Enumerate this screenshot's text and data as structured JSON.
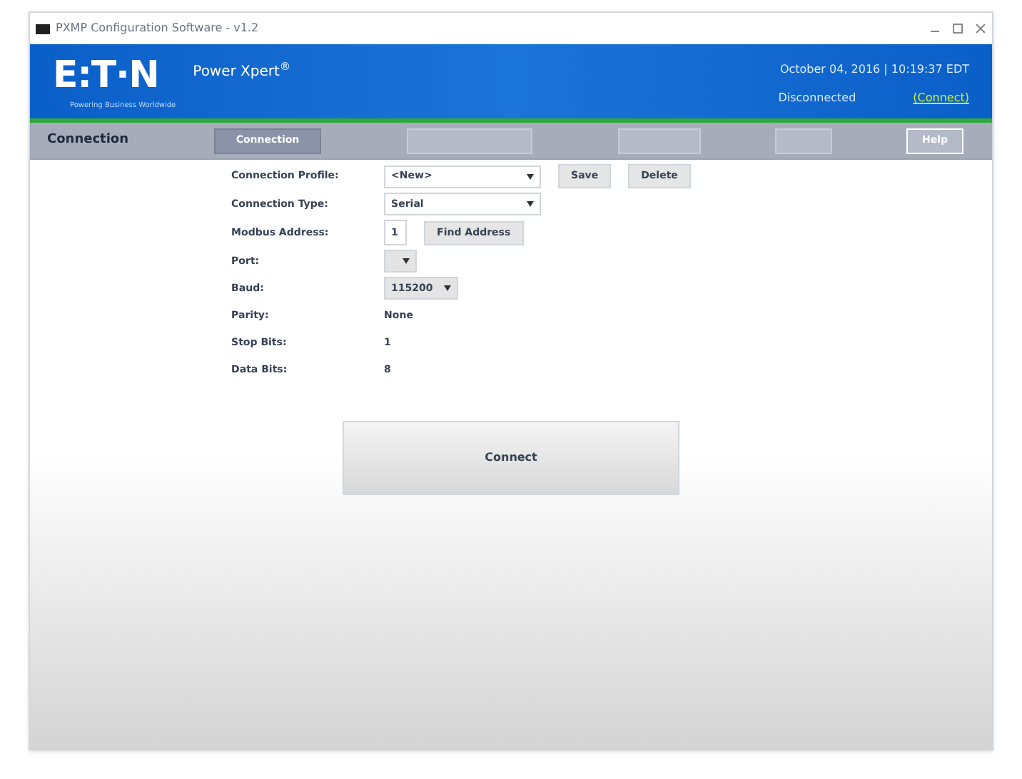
{
  "window": {
    "title": "PXMP Configuration Software - v1.2"
  },
  "header": {
    "logo": "E:T·N",
    "tagline": "Powering Business Worldwide",
    "product": "Power Xpert",
    "product_sup": "®",
    "datetime": "October 04, 2016 | 10:19:37 EDT",
    "status": "Disconnected",
    "connect_link": "(Connect)"
  },
  "section_title": "Connection",
  "tabs": [
    {
      "label": "Connection",
      "selected": true,
      "disabled": false
    },
    {
      "selected": false,
      "disabled": true
    },
    {
      "selected": false,
      "disabled": true
    },
    {
      "selected": false,
      "disabled": true
    },
    {
      "label": "Help",
      "selected": false,
      "disabled": false
    }
  ],
  "form": [
    {
      "kind": "select",
      "label": "Connection Profile:",
      "value": "<New>",
      "buttons": [
        "Save",
        "Delete"
      ]
    },
    {
      "kind": "select",
      "label": "Connection Type:",
      "value": "Serial"
    },
    {
      "kind": "input",
      "label": "Modbus Address:",
      "value": "1",
      "buttons": [
        "Find Address"
      ]
    },
    {
      "kind": "smallselect",
      "label": "Port:"
    },
    {
      "kind": "smallselect",
      "label": "Baud:",
      "value": "115200"
    },
    {
      "kind": "text",
      "label": "Parity:",
      "value": "None"
    },
    {
      "kind": "text",
      "label": "Stop Bits:",
      "value": "1"
    },
    {
      "kind": "text",
      "label": "Data Bits:",
      "value": "8"
    }
  ],
  "connect_button": "Connect"
}
